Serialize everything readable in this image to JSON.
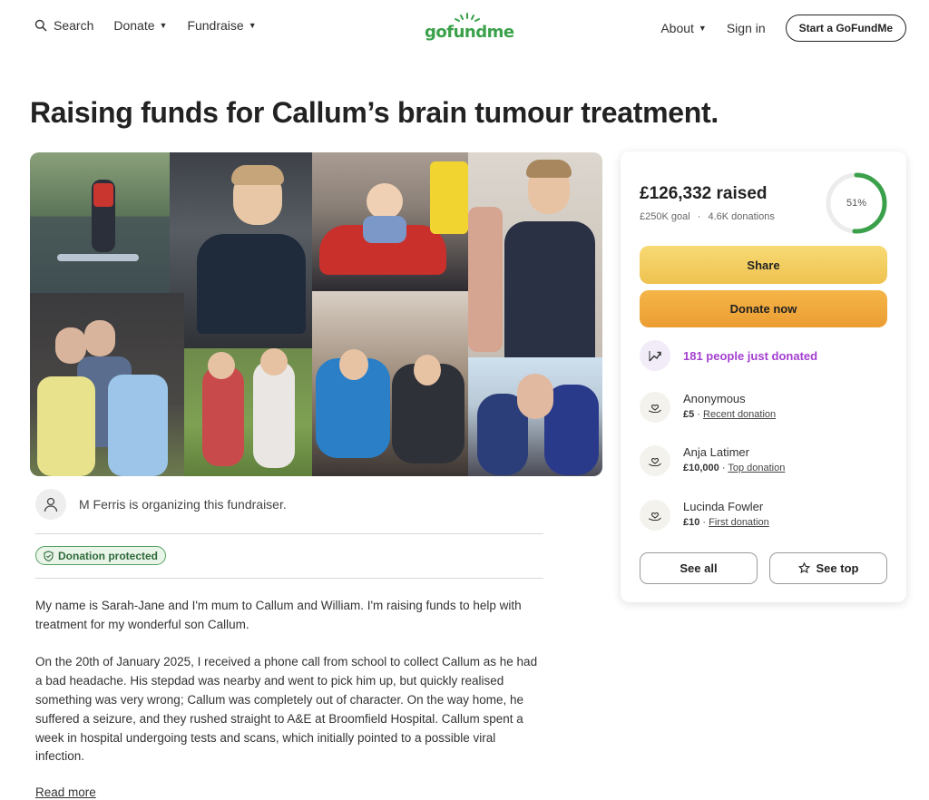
{
  "header": {
    "search_label": "Search",
    "donate_label": "Donate",
    "fundraise_label": "Fundraise",
    "logo_text": "gofundme",
    "about_label": "About",
    "signin_label": "Sign in",
    "start_label": "Start a GoFundMe",
    "brand_color": "#3aa14a"
  },
  "campaign": {
    "title": "Raising funds for Callum’s brain tumour treatment.",
    "organizer_text": "M Ferris is organizing this fundraiser.",
    "protected_label": "Donation protected",
    "story": [
      "My name is Sarah-Jane and I'm mum to Callum and William. I'm raising funds to help with treatment for my wonderful son Callum.",
      "On the 20th of January 2025, I received a phone call from school to collect Callum as he had a bad headache. His stepdad was nearby and went to pick him up, but quickly realised something was very wrong; Callum was completely out of character. On the way home, he suffered a seizure, and they rushed straight to A&E at Broomfield Hospital. Callum spent a week in hospital undergoing tests and scans, which initially pointed to a possible viral infection."
    ],
    "read_more": "Read more"
  },
  "card": {
    "raised": "£126,332 raised",
    "goal": "£250K goal",
    "donations": "4.6K donations",
    "progress_percent": 51,
    "progress_label": "51%",
    "share_label": "Share",
    "donate_label": "Donate now",
    "trend_text": "181 people just donated",
    "donors": [
      {
        "name": "Anonymous",
        "amount": "£5",
        "tag": "Recent donation"
      },
      {
        "name": "Anja Latimer",
        "amount": "£10,000",
        "tag": "Top donation"
      },
      {
        "name": "Lucinda Fowler",
        "amount": "£10",
        "tag": "First donation"
      }
    ],
    "see_all_label": "See all",
    "see_top_label": "See top",
    "accent_purple": "#a43fd0",
    "progress_green": "#3aa14a"
  }
}
